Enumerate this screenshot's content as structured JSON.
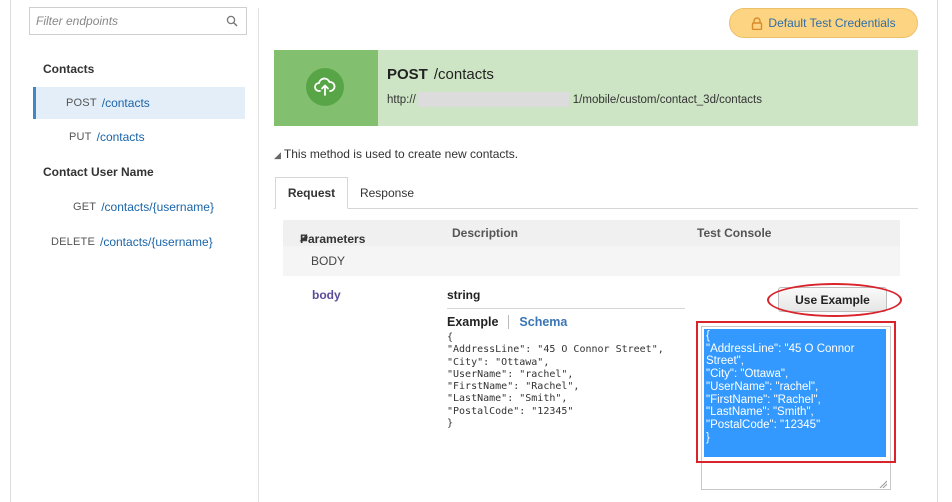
{
  "sidebar": {
    "filter_placeholder": "Filter endpoints",
    "groups": [
      {
        "title": "Contacts",
        "items": [
          {
            "verb": "POST",
            "path": "/contacts",
            "active": true
          },
          {
            "verb": "PUT",
            "path": "/contacts",
            "active": false
          }
        ]
      },
      {
        "title": "Contact User Name",
        "items": [
          {
            "verb": "GET",
            "path": "/contacts/{username}",
            "active": false
          },
          {
            "verb": "DELETE",
            "path": "/contacts/{username}",
            "active": false
          }
        ]
      }
    ]
  },
  "credentials_button": "Default Test Credentials",
  "endpoint": {
    "method": "POST",
    "path": "/contacts",
    "url_prefix": "http://",
    "url_suffix": "1/mobile/custom/contact_3d/contacts",
    "description": "This method is used to create new contacts.",
    "header_color": "#cde5c5",
    "icon_bg_color": "#82bf6e"
  },
  "tabs": [
    {
      "label": "Request",
      "active": true
    },
    {
      "label": "Response",
      "active": false
    }
  ],
  "params": {
    "columns": [
      "Parameters",
      "Description",
      "Test Console"
    ],
    "section": "BODY",
    "name": "body",
    "type": "string",
    "example_tabs": [
      "Example",
      "Schema"
    ],
    "example_lines": [
      "{",
      "\"AddressLine\": \"45 O Connor Street\",",
      "\"City\": \"Ottawa\",",
      "\"UserName\": \"rachel\",",
      "\"FirstName\": \"Rachel\",",
      "\"LastName\": \"Smith\",",
      "\"PostalCode\": \"12345\"",
      "}"
    ]
  },
  "console": {
    "use_example_label": "Use Example",
    "lines": [
      "{",
      "\"AddressLine\": \"45 O Connor Street\",",
      "\"City\": \"Ottawa\",",
      "\"UserName\": \"rachel\",",
      "\"FirstName\": \"Rachel\",",
      "\"LastName\": \"Smith\",",
      "\"PostalCode\": \"12345\"",
      "}"
    ],
    "selection_color": "#3399ff",
    "annotation_color": "#d9242c"
  }
}
